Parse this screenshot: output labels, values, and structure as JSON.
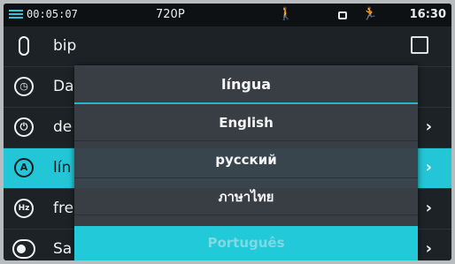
{
  "status_bar": {
    "record_time": "00:05:07",
    "resolution": "720P",
    "clock": "16:30",
    "icons": [
      "record-menu-icon",
      "pedestrian-icon",
      "lock-icon",
      "walking-icon"
    ]
  },
  "settings": {
    "items": [
      {
        "label": "bip",
        "icon": "microphone-icon",
        "control": "checkbox"
      },
      {
        "label": "Da",
        "icon": "clock-icon",
        "control": "none"
      },
      {
        "label": "de",
        "icon": "power-icon",
        "control": "arrow"
      },
      {
        "label": "lín",
        "icon": "language-icon",
        "control": "arrow",
        "active": true
      },
      {
        "label": "fre",
        "icon": "frequency-icon",
        "control": "arrow"
      },
      {
        "label": "Sa",
        "icon": "toggle-icon",
        "control": "arrow"
      }
    ],
    "icon_glyphs": {
      "clock": "◷",
      "power": "⏻",
      "language": "A",
      "frequency": "Hz"
    },
    "arrow_glyph": "›"
  },
  "language_dialog": {
    "title": "língua",
    "options": [
      {
        "label": "English"
      },
      {
        "label": "русский"
      },
      {
        "label": "ภาษาไทย"
      },
      {
        "label": "Português",
        "selected": true
      }
    ]
  },
  "colors": {
    "accent": "#23c6d6",
    "background": "#1d2226",
    "popup": "#3a4046"
  }
}
